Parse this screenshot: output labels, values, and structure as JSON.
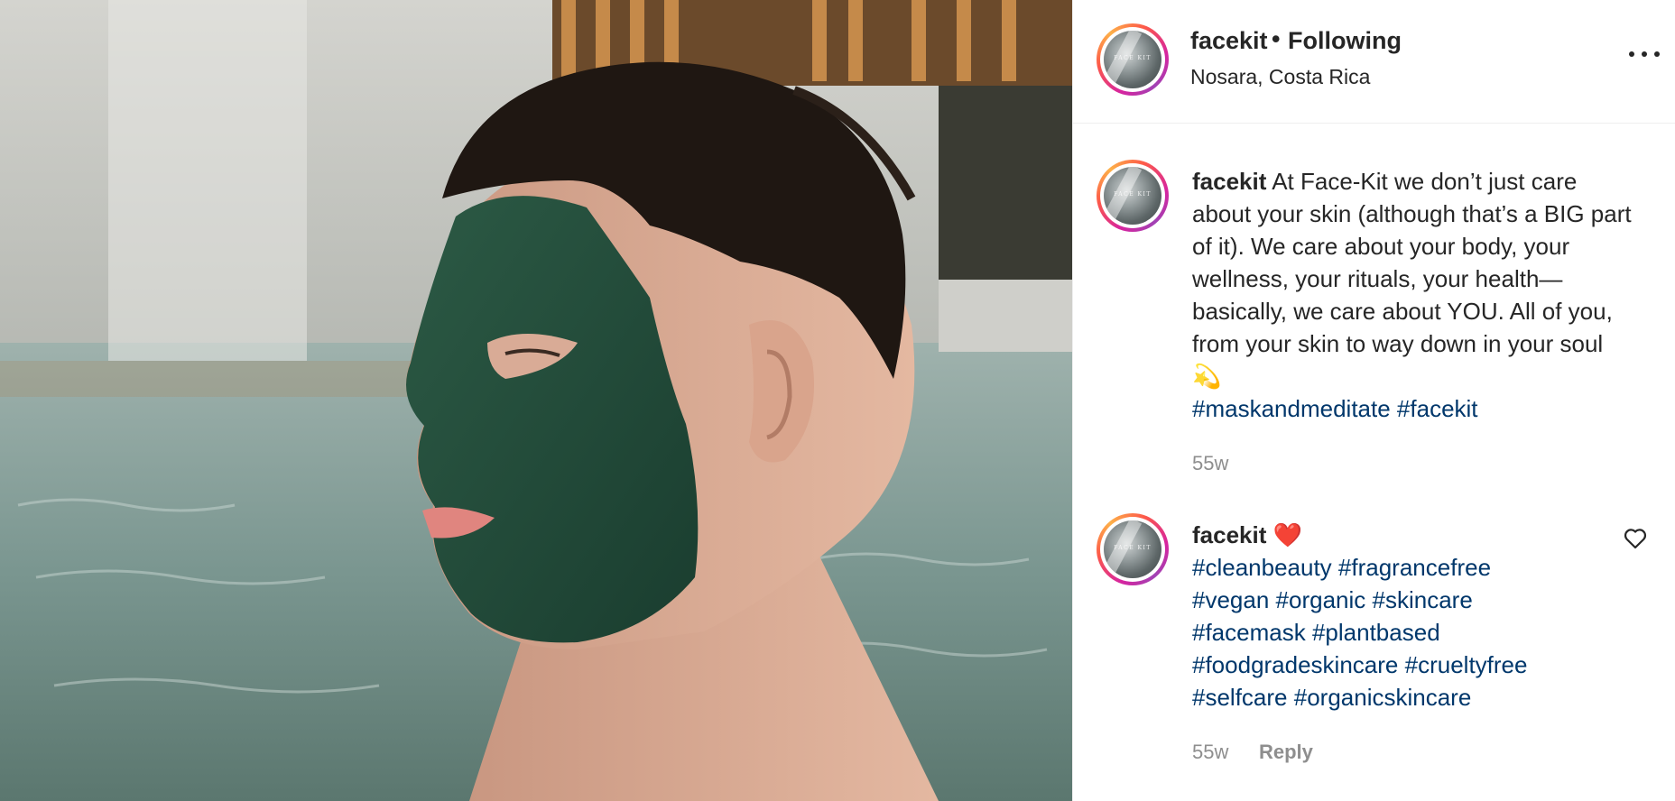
{
  "post": {
    "photo_alt": "",
    "header": {
      "username": "facekit",
      "bullet": "•",
      "follow_status": "Following",
      "location": "Nosara, Costa Rica",
      "more_icon": "more-horizontal-icon",
      "avatar_logo": "FACE KIT"
    },
    "caption": {
      "username": "facekit",
      "text": "At Face-Kit we don’t just care about your skin (although that’s a BIG part of it). We care about your body, your wellness, your rituals, your health—basically, we care about YOU. All of you, from your skin to way down in your soul 💫",
      "hashtags": [
        "#maskandmeditate",
        "#facekit"
      ],
      "age": "55w"
    },
    "comment": {
      "username": "facekit",
      "emoji": "❤️",
      "hashtags": [
        "#cleanbeauty",
        "#fragrancefree",
        "#vegan",
        "#organic",
        "#skincare",
        "#facemask",
        "#plantbased",
        "#foodgradeskincare",
        "#crueltyfree",
        "#selfcare",
        "#organicskincare"
      ],
      "age": "55w",
      "reply_label": "Reply",
      "like_icon": "heart-outline-icon"
    }
  },
  "colors": {
    "text": "#262626",
    "muted": "#8e8e8e",
    "hashtag": "#00376b",
    "divider": "#efefef"
  }
}
